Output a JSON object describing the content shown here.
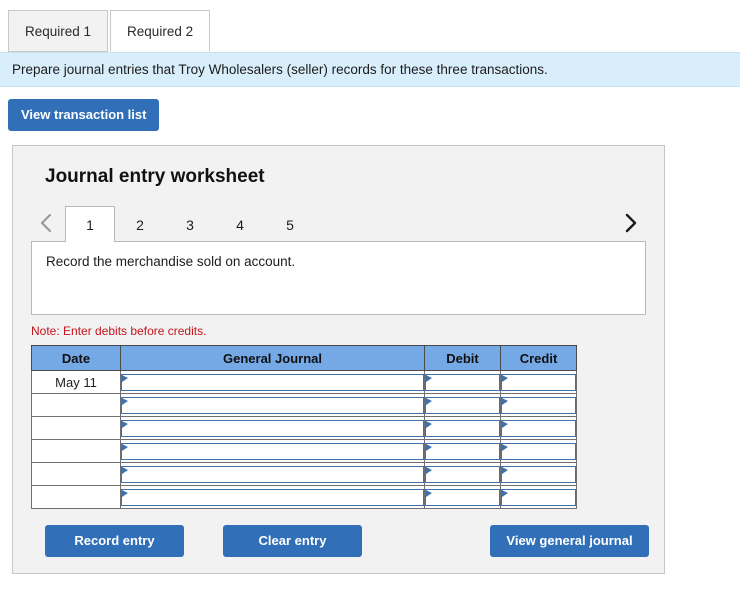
{
  "requirement_tabs": [
    {
      "label": "Required 1",
      "active": false
    },
    {
      "label": "Required 2",
      "active": true
    }
  ],
  "info_banner": {
    "text": "Prepare journal entries that Troy Wholesalers (seller) records for these three transactions."
  },
  "toolbar": {
    "view_transaction_list_label": "View transaction list"
  },
  "worksheet": {
    "title": "Journal entry worksheet",
    "prev_icon": "chevron-left-icon",
    "next_icon": "chevron-right-icon",
    "tabs": [
      {
        "label": "1",
        "active": true
      },
      {
        "label": "2",
        "active": false
      },
      {
        "label": "3",
        "active": false
      },
      {
        "label": "4",
        "active": false
      },
      {
        "label": "5",
        "active": false
      }
    ],
    "description": "Record the merchandise sold on account.",
    "note": "Note: Enter debits before credits."
  },
  "journal_table": {
    "headers": [
      "Date",
      "General Journal",
      "Debit",
      "Credit"
    ],
    "rows": [
      {
        "date": "May 11",
        "general_journal": "",
        "debit": "",
        "credit": ""
      },
      {
        "date": "",
        "general_journal": "",
        "debit": "",
        "credit": ""
      },
      {
        "date": "",
        "general_journal": "",
        "debit": "",
        "credit": ""
      },
      {
        "date": "",
        "general_journal": "",
        "debit": "",
        "credit": ""
      },
      {
        "date": "",
        "general_journal": "",
        "debit": "",
        "credit": ""
      },
      {
        "date": "",
        "general_journal": "",
        "debit": "",
        "credit": ""
      }
    ]
  },
  "footer": {
    "record_entry_label": "Record entry",
    "clear_entry_label": "Clear entry",
    "view_general_journal_label": "View general journal"
  },
  "colors": {
    "button_blue": "#3170b8",
    "table_header_blue": "#74a9e6",
    "banner_blue": "#d9eefb",
    "note_red": "#c4151c",
    "panel_gray": "#f2f2f2"
  }
}
